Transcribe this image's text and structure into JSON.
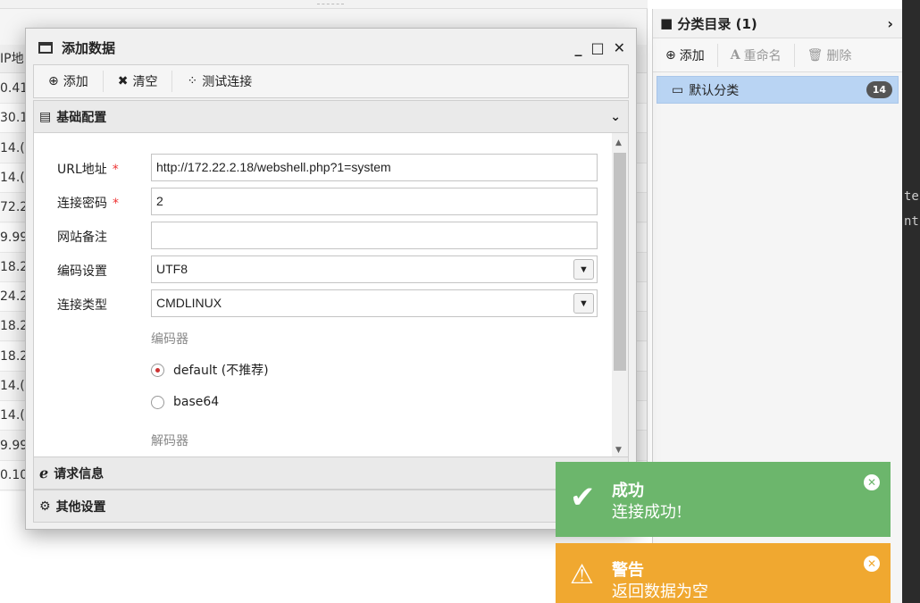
{
  "background_table": {
    "header_fragment": "IP地",
    "rows": [
      "0.41",
      "30.1",
      "14.(",
      "14.(",
      "72.2",
      "9.99",
      "18.2",
      "24.2",
      "18.2",
      "18.2",
      "14.(",
      "14.(",
      "9.99",
      "0.10"
    ]
  },
  "category_panel": {
    "title": "分类目录 (1)",
    "toolbar": {
      "add": "添加",
      "rename": "重命名",
      "delete": "删除"
    },
    "items": [
      {
        "label": "默认分类",
        "count": "14"
      }
    ]
  },
  "terminal_fragments": [
    "te",
    "nt"
  ],
  "dialog": {
    "title": "添加数据",
    "toolbar": {
      "add": "添加",
      "clear": "清空",
      "test_connection": "测试连接"
    },
    "sections": {
      "basic": "基础配置",
      "request": "请求信息",
      "other": "其他设置"
    },
    "form": {
      "url_label": "URL地址",
      "url_value": "http://172.22.2.18/webshell.php?1=system",
      "password_label": "连接密码",
      "password_value": "2",
      "note_label": "网站备注",
      "note_value": "",
      "encoding_label": "编码设置",
      "encoding_value": "UTF8",
      "type_label": "连接类型",
      "type_value": "CMDLINUX",
      "encoder_label": "编码器",
      "encoder_options": [
        "default (不推荐)",
        "base64"
      ],
      "encoder_selected": "default (不推荐)",
      "decoder_label": "解码器",
      "required_mark": "*"
    }
  },
  "toasts": {
    "success": {
      "title": "成功",
      "message": "连接成功!"
    },
    "warning": {
      "title": "警告",
      "message": "返回数据为空"
    }
  }
}
